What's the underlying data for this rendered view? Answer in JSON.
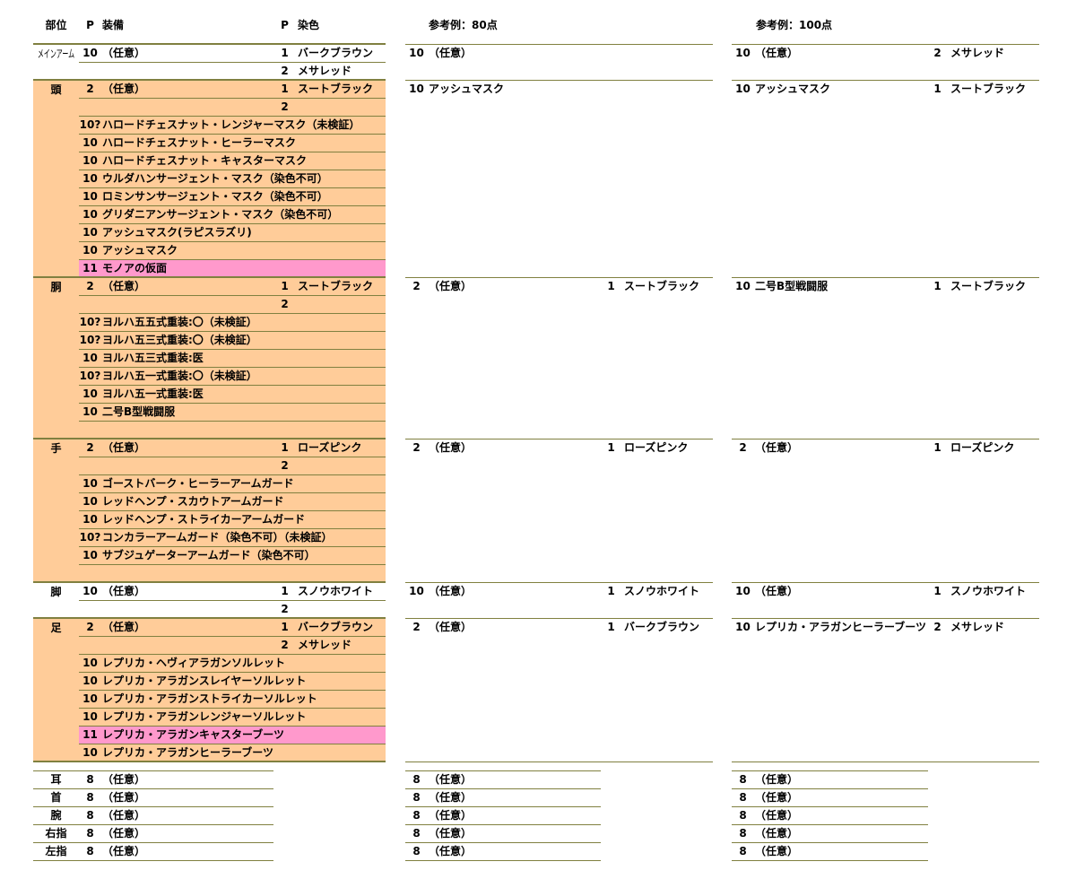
{
  "colors": {
    "shaded_bg": "#ffcc99",
    "highlight_bg": "#ff99cc",
    "rule": "#808040",
    "text": "#000000"
  },
  "header": {
    "part": "部位",
    "equip_p": "P",
    "equip": "装備",
    "dye_p": "P",
    "dye": "染色",
    "ref80": "参考例：80点",
    "ref100": "参考例：100点"
  },
  "gear": [
    {
      "part": "メインアーム",
      "shaded": false,
      "rows": [
        {
          "p": "10",
          "equip": "（任意）",
          "dp": "1",
          "dye": "バークブラウン"
        },
        {
          "dp": "2",
          "dye": "メサレッド"
        }
      ],
      "ref80": {
        "p": "10",
        "equip": "（任意）"
      },
      "ref100": {
        "p": "10",
        "equip": "（任意）",
        "dp": "2",
        "dye": "メサレッド"
      }
    },
    {
      "part": "頭",
      "shaded": true,
      "rows": [
        {
          "p": "2",
          "equip": "（任意）",
          "dp": "1",
          "dye": "スートブラック"
        },
        {
          "dp": "2"
        },
        {
          "p": "10?",
          "equip": "ハロードチェスナット・レンジャーマスク（未検証）"
        },
        {
          "p": "10",
          "equip": "ハロードチェスナット・ヒーラーマスク"
        },
        {
          "p": "10",
          "equip": "ハロードチェスナット・キャスターマスク"
        },
        {
          "p": "10",
          "equip": "ウルダハンサージェント・マスク（染色不可）"
        },
        {
          "p": "10",
          "equip": "ロミンサンサージェント・マスク（染色不可）"
        },
        {
          "p": "10",
          "equip": "グリダニアンサージェント・マスク（染色不可）"
        },
        {
          "p": "10",
          "equip": "アッシュマスク(ラピスラズリ)"
        },
        {
          "p": "10",
          "equip": "アッシュマスク"
        },
        {
          "p": "11",
          "equip": "モノアの仮面",
          "highlight": true
        }
      ],
      "ref80": {
        "p": "10",
        "equip": "アッシュマスク"
      },
      "ref100": {
        "p": "10",
        "equip": "アッシュマスク",
        "dp": "1",
        "dye": "スートブラック"
      }
    },
    {
      "part": "胴",
      "shaded": true,
      "rows": [
        {
          "p": "2",
          "equip": "（任意）",
          "dp": "1",
          "dye": "スートブラック"
        },
        {
          "dp": "2"
        },
        {
          "p": "10?",
          "equip": "ヨルハ五五式重装:〇（未検証）"
        },
        {
          "p": "10?",
          "equip": "ヨルハ五三式重装:〇（未検証）"
        },
        {
          "p": "10",
          "equip": "ヨルハ五三式重装:医"
        },
        {
          "p": "10?",
          "equip": "ヨルハ五一式重装:〇（未検証）"
        },
        {
          "p": "10",
          "equip": "ヨルハ五一式重装:医"
        },
        {
          "p": "10",
          "equip": "二号B型戦闘服"
        },
        {}
      ],
      "ref80": {
        "p": "2",
        "equip": "（任意）",
        "dp": "1",
        "dye": "スートブラック"
      },
      "ref100": {
        "p": "10",
        "equip": "二号B型戦闘服",
        "dp": "1",
        "dye": "スートブラック"
      }
    },
    {
      "part": "手",
      "shaded": true,
      "rows": [
        {
          "p": "2",
          "equip": "（任意）",
          "dp": "1",
          "dye": "ローズピンク"
        },
        {
          "dp": "2"
        },
        {
          "p": "10",
          "equip": "ゴーストバーク・ヒーラーアームガード"
        },
        {
          "p": "10",
          "equip": "レッドヘンプ・スカウトアームガード"
        },
        {
          "p": "10",
          "equip": "レッドヘンプ・ストライカーアームガード"
        },
        {
          "p": "10?",
          "equip": "コンカラーアームガード（染色不可）（未検証）"
        },
        {
          "p": "10",
          "equip": "サブジュゲーターアームガード（染色不可）"
        },
        {}
      ],
      "ref80": {
        "p": "2",
        "equip": "（任意）",
        "dp": "1",
        "dye": "ローズピンク"
      },
      "ref100": {
        "p": "2",
        "equip": "（任意）",
        "dp": "1",
        "dye": "ローズピンク"
      }
    },
    {
      "part": "脚",
      "shaded": false,
      "rows": [
        {
          "p": "10",
          "equip": "（任意）",
          "dp": "1",
          "dye": "スノウホワイト"
        },
        {
          "dp": "2"
        }
      ],
      "ref80": {
        "p": "10",
        "equip": "（任意）",
        "dp": "1",
        "dye": "スノウホワイト"
      },
      "ref100": {
        "p": "10",
        "equip": "（任意）",
        "dp": "1",
        "dye": "スノウホワイト"
      }
    },
    {
      "part": "足",
      "shaded": true,
      "rows": [
        {
          "p": "2",
          "equip": "（任意）",
          "dp": "1",
          "dye": "バークブラウン"
        },
        {
          "dp": "2",
          "dye": "メサレッド"
        },
        {
          "p": "10",
          "equip": "レプリカ・ヘヴィアラガンソルレット"
        },
        {
          "p": "10",
          "equip": "レプリカ・アラガンスレイヤーソルレット"
        },
        {
          "p": "10",
          "equip": "レプリカ・アラガンストライカーソルレット"
        },
        {
          "p": "10",
          "equip": "レプリカ・アラガンレンジャーソルレット"
        },
        {
          "p": "11",
          "equip": "レプリカ・アラガンキャスターブーツ",
          "highlight": true
        },
        {
          "p": "10",
          "equip": "レプリカ・アラガンヒーラーブーツ"
        }
      ],
      "ref80": {
        "p": "2",
        "equip": "（任意）",
        "dp": "1",
        "dye": "バークブラウン"
      },
      "ref100": {
        "p": "10",
        "equip": "レプリカ・アラガンヒーラーブーツ",
        "dp": "2",
        "dye": "メサレッド"
      }
    }
  ],
  "accessories": [
    {
      "part": "耳",
      "p": "8",
      "equip": "（任意）",
      "ref80": {
        "p": "8",
        "equip": "（任意）"
      },
      "ref100": {
        "p": "8",
        "equip": "（任意）"
      }
    },
    {
      "part": "首",
      "p": "8",
      "equip": "（任意）",
      "ref80": {
        "p": "8",
        "equip": "（任意）"
      },
      "ref100": {
        "p": "8",
        "equip": "（任意）"
      }
    },
    {
      "part": "腕",
      "p": "8",
      "equip": "（任意）",
      "ref80": {
        "p": "8",
        "equip": "（任意）"
      },
      "ref100": {
        "p": "8",
        "equip": "（任意）"
      }
    },
    {
      "part": "右指",
      "p": "8",
      "equip": "（任意）",
      "ref80": {
        "p": "8",
        "equip": "（任意）"
      },
      "ref100": {
        "p": "8",
        "equip": "（任意）"
      }
    },
    {
      "part": "左指",
      "p": "8",
      "equip": "（任意）",
      "ref80": {
        "p": "8",
        "equip": "（任意）"
      },
      "ref100": {
        "p": "8",
        "equip": "（任意）"
      }
    }
  ]
}
